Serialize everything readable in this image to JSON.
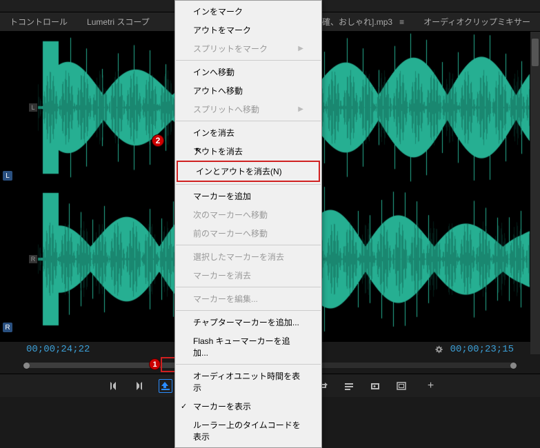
{
  "tabs": {
    "control": "トコントロール",
    "lumetri": "Lumetri スコープ",
    "sourceClip": "確、おしゃれ].mp3",
    "audioMixer": "オーディオクリップミキサー"
  },
  "time": {
    "current": "00;00;24;22",
    "duration": "00;00;23;15"
  },
  "channels": {
    "left": "L",
    "right": "R"
  },
  "contextMenu": {
    "items": [
      {
        "label": "インをマーク",
        "type": "item"
      },
      {
        "label": "アウトをマーク",
        "type": "item"
      },
      {
        "label": "スプリットをマーク",
        "type": "item",
        "disabled": true,
        "hasSub": true
      },
      {
        "type": "sep"
      },
      {
        "label": "インへ移動",
        "type": "item"
      },
      {
        "label": "アウトへ移動",
        "type": "item"
      },
      {
        "label": "スプリットへ移動",
        "type": "item",
        "disabled": true,
        "hasSub": true
      },
      {
        "type": "sep"
      },
      {
        "label": "インを消去",
        "type": "item"
      },
      {
        "label": "アウトを消去",
        "type": "item"
      },
      {
        "label": "インとアウトを消去(N)",
        "type": "item",
        "highlighted": true
      },
      {
        "type": "sep"
      },
      {
        "label": "マーカーを追加",
        "type": "item"
      },
      {
        "label": "次のマーカーへ移動",
        "type": "item",
        "disabled": true
      },
      {
        "label": "前のマーカーへ移動",
        "type": "item",
        "disabled": true
      },
      {
        "type": "sep"
      },
      {
        "label": "選択したマーカーを消去",
        "type": "item",
        "disabled": true
      },
      {
        "label": "マーカーを消去",
        "type": "item",
        "disabled": true
      },
      {
        "type": "sep"
      },
      {
        "label": "マーカーを編集...",
        "type": "item",
        "disabled": true
      },
      {
        "type": "sep"
      },
      {
        "label": "チャプターマーカーを追加...",
        "type": "item"
      },
      {
        "label": "Flash キューマーカーを追加...",
        "type": "item"
      },
      {
        "type": "sep"
      },
      {
        "label": "オーディオユニット時間を表示",
        "type": "item"
      },
      {
        "label": "マーカーを表示",
        "type": "item",
        "checked": true
      },
      {
        "label": "ルーラー上のタイムコードを表示",
        "type": "item"
      }
    ]
  },
  "callouts": {
    "one": "1",
    "two": "2"
  },
  "transport": {
    "markIn": "mark-in",
    "markOut": "mark-out",
    "insert": "insert",
    "stepBack": "step-back",
    "play": "play",
    "stepFwd": "step-fwd",
    "goIn": "go-in",
    "goOut": "go-out",
    "loop": "loop",
    "snapshot": "snapshot",
    "export": "export",
    "safe": "safe",
    "plus": "+"
  },
  "colors": {
    "waveform": "#28b89a",
    "accent": "#2a8cff",
    "highlight": "#d02020"
  }
}
